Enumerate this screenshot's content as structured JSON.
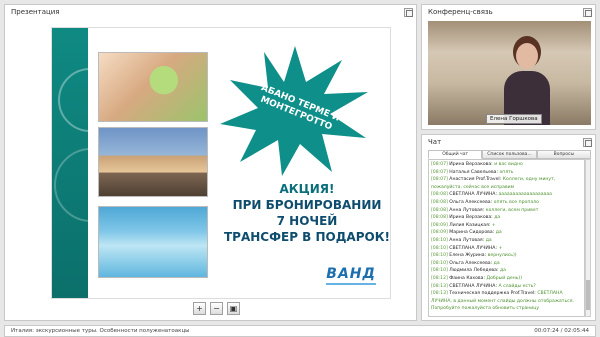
{
  "presentation": {
    "title": "Презентация",
    "slide": {
      "stamp_lines": [
        "АБАНО ТЕРМЕ И",
        "МОНТЕГРОТТО"
      ],
      "promo": [
        "АКЦИЯ!",
        "ПРИ БРОНИРОВАНИИ",
        "7 НОЧЕЙ",
        "ТРАНСФЕР В ПОДАРОК!"
      ],
      "logo": "ВАНД",
      "colors": {
        "accent": "#0f8a83",
        "promo_text": "#0f4d6f",
        "star": "#0e8f89"
      }
    },
    "tools": [
      {
        "name": "zoom-in-icon",
        "glyph": "+"
      },
      {
        "name": "zoom-out-icon",
        "glyph": "−"
      },
      {
        "name": "save-icon",
        "glyph": "▣"
      }
    ]
  },
  "conference": {
    "title": "Конференц-связь",
    "participant_name": "Елена Горшкова"
  },
  "chat": {
    "title": "Чат",
    "tabs": [
      "Общий чат",
      "Список пользова...",
      "Вопросы"
    ],
    "messages": [
      {
        "time": "[08:07]",
        "author": "Ирина Верзакова:",
        "text": "и вас видно"
      },
      {
        "time": "[08:07]",
        "author": "Наталья Савельева:",
        "text": "опять"
      },
      {
        "time": "[08:07]",
        "author": "Анастасия Prof.Travel:",
        "text": "Коллеги, одну минут, пожалуйста, сейчас все исправим"
      },
      {
        "time": "[08:08]",
        "author": "СВЕТЛАНА ЛУЧИНА:",
        "text": "ааааааааааааааааааа"
      },
      {
        "time": "[08:08]",
        "author": "Ольга Алексеева:",
        "text": "опять все пропало"
      },
      {
        "time": "[08:08]",
        "author": "Анна Лутовая:",
        "text": "коллеги, всем привет"
      },
      {
        "time": "[08:08]",
        "author": "Ирина Верзакова:",
        "text": "да"
      },
      {
        "time": "[08:09]",
        "author": "Лилия Казицкая:",
        "text": "+"
      },
      {
        "time": "[08:09]",
        "author": "Марина Сидорова:",
        "text": "да"
      },
      {
        "time": "[08:10]",
        "author": "Анна Лутовая:",
        "text": "да"
      },
      {
        "time": "[08:10]",
        "author": "СВЕТЛАНА ЛУЧИНА:",
        "text": "+"
      },
      {
        "time": "[08:10]",
        "author": "Елена Журина:",
        "text": "вернулись))"
      },
      {
        "time": "[08:10]",
        "author": "Ольга Алексеева:",
        "text": "да"
      },
      {
        "time": "[08:10]",
        "author": "Людмила Лебедева:",
        "text": "да"
      },
      {
        "time": "[08:12]",
        "author": "Фаина Кахова:",
        "text": "Добрый день))"
      },
      {
        "time": "[08:13]",
        "author": "СВЕТЛАНА ЛУЧИНА:",
        "text": "А слайды есть?"
      },
      {
        "time": "[08:13]",
        "author": "Техническая поддержка Prof.Travel:",
        "text": "СВЕТЛАНА ЛУЧИНА, в данный момент слайды должны отображаться. Попробуйте пожалуйста обновить страницу"
      }
    ]
  },
  "status_bar": {
    "title": "Италия: экскурсионные туры. Особенности полуженатоакцы",
    "time": "00:07:24 / 02:05:44"
  }
}
